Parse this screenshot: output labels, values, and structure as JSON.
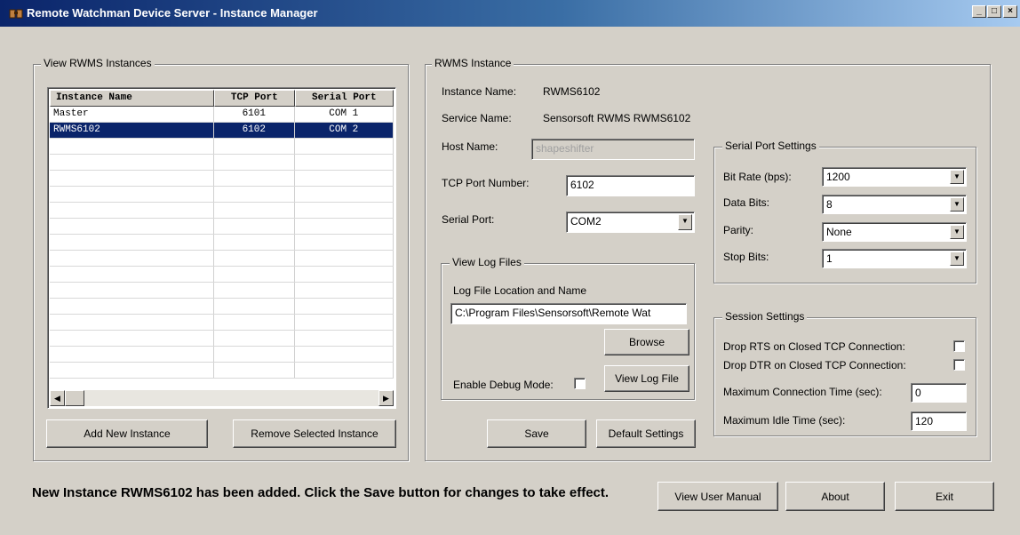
{
  "window": {
    "title": "Remote Watchman Device Server - Instance Manager",
    "controls": {
      "minimize": "_",
      "maximize": "□",
      "close": "×"
    }
  },
  "instances_panel": {
    "label": "View RWMS Instances",
    "columns": [
      "Instance Name",
      "TCP Port",
      "Serial Port"
    ],
    "rows": [
      {
        "name": "Master",
        "tcp": "6101",
        "serial": "COM  1",
        "selected": false
      },
      {
        "name": "RWMS6102",
        "tcp": "6102",
        "serial": "COM  2",
        "selected": true
      }
    ],
    "add_button": "Add New Instance",
    "remove_button": "Remove Selected Instance"
  },
  "instance": {
    "label": "RWMS Instance",
    "instance_name_label": "Instance Name:",
    "instance_name_value": "RWMS6102",
    "service_name_label": "Service Name:",
    "service_name_value": "Sensorsoft RWMS RWMS6102",
    "host_name_label": "Host Name:",
    "host_name_value": "shapeshifter",
    "tcp_port_label": "TCP Port Number:",
    "tcp_port_value": "6102",
    "serial_port_label": "Serial Port:",
    "serial_port_value": "COM2",
    "log": {
      "label": "View Log Files",
      "location_label": "Log File Location and Name",
      "location_value": "C:\\Program Files\\Sensorsoft\\Remote Wat",
      "browse_button": "Browse",
      "debug_label": "Enable Debug Mode:",
      "debug_checked": false,
      "view_log_button": "View Log File"
    },
    "serial_settings": {
      "label": "Serial Port Settings",
      "bit_rate_label": "Bit Rate (bps):",
      "bit_rate_value": "1200",
      "data_bits_label": "Data Bits:",
      "data_bits_value": "8",
      "parity_label": "Parity:",
      "parity_value": "None",
      "stop_bits_label": "Stop Bits:",
      "stop_bits_value": "1"
    },
    "session_settings": {
      "label": "Session Settings",
      "drop_rts_label": "Drop RTS on Closed TCP Connection:",
      "drop_rts_checked": false,
      "drop_dtr_label": "Drop DTR on Closed TCP Connection:",
      "drop_dtr_checked": false,
      "max_conn_label": "Maximum Connection Time (sec):",
      "max_conn_value": "0",
      "max_idle_label": "Maximum Idle Time (sec):",
      "max_idle_value": "120"
    },
    "save_button": "Save",
    "default_button": "Default Settings"
  },
  "footer": {
    "status_message": "New Instance RWMS6102 has been added. Click the Save button for changes to take effect.",
    "manual_button": "View User Manual",
    "about_button": "About",
    "exit_button": "Exit"
  },
  "icons": {
    "combo": "dropdown-arrow-icon",
    "scroll_left": "scroll-left-icon",
    "scroll_right": "scroll-right-icon",
    "app": "app-icon"
  },
  "colors": {
    "face": "#d4d0c8",
    "title_active": "#0a246a",
    "selection": "#0a246a"
  }
}
